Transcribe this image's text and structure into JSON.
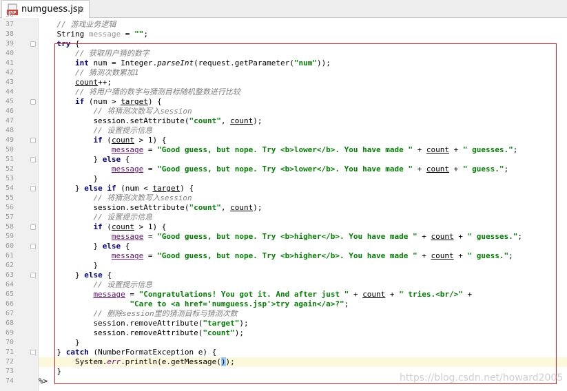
{
  "tab": {
    "title": "numguess.jsp",
    "close": "×"
  },
  "editor": {
    "lines": [
      {
        "n": "36",
        "tokens": []
      },
      {
        "n": "37",
        "indent": 4,
        "tokens": [
          {
            "t": "// 游戏业务逻辑",
            "c": "cmt"
          }
        ]
      },
      {
        "n": "38",
        "indent": 4,
        "tokens": [
          {
            "t": "String "
          },
          {
            "t": "message",
            "c": "fadevar"
          },
          {
            "t": " = "
          },
          {
            "t": "\"\"",
            "c": "str"
          },
          {
            "t": ";"
          }
        ]
      },
      {
        "n": "39",
        "indent": 4,
        "fold": true,
        "tokens": [
          {
            "t": "try",
            "c": "kw"
          },
          {
            "t": " {"
          }
        ]
      },
      {
        "n": "40",
        "indent": 8,
        "tokens": [
          {
            "t": "// 获取用户猜的数字",
            "c": "cmt"
          }
        ]
      },
      {
        "n": "41",
        "indent": 8,
        "tokens": [
          {
            "t": "int",
            "c": "kw"
          },
          {
            "t": " num = Integer."
          },
          {
            "t": "parseInt",
            "c": "mth"
          },
          {
            "t": "(request.getParameter("
          },
          {
            "t": "\"num\"",
            "c": "str"
          },
          {
            "t": "));"
          }
        ]
      },
      {
        "n": "42",
        "indent": 8,
        "tokens": [
          {
            "t": "// 猜测次数累加1",
            "c": "cmt"
          }
        ]
      },
      {
        "n": "43",
        "indent": 8,
        "tokens": [
          {
            "t": "count",
            "c": "var"
          },
          {
            "t": "++;"
          }
        ]
      },
      {
        "n": "44",
        "indent": 8,
        "tokens": [
          {
            "t": "// 将用户猜的数字与猜测目标随机整数进行比较",
            "c": "cmt"
          }
        ]
      },
      {
        "n": "45",
        "indent": 8,
        "fold": true,
        "tokens": [
          {
            "t": "if",
            "c": "kw"
          },
          {
            "t": " (num > "
          },
          {
            "t": "target",
            "c": "var"
          },
          {
            "t": ") {"
          }
        ]
      },
      {
        "n": "46",
        "indent": 12,
        "tokens": [
          {
            "t": "// 将猜测次数写入session",
            "c": "cmt"
          }
        ]
      },
      {
        "n": "47",
        "indent": 12,
        "tokens": [
          {
            "t": "session.setAttribute("
          },
          {
            "t": "\"count\"",
            "c": "str"
          },
          {
            "t": ", "
          },
          {
            "t": "count",
            "c": "var"
          },
          {
            "t": ");"
          }
        ]
      },
      {
        "n": "48",
        "indent": 12,
        "tokens": [
          {
            "t": "// 设置提示信息",
            "c": "cmt"
          }
        ]
      },
      {
        "n": "49",
        "indent": 12,
        "fold": true,
        "tokens": [
          {
            "t": "if",
            "c": "kw"
          },
          {
            "t": " ("
          },
          {
            "t": "count",
            "c": "var"
          },
          {
            "t": " > 1) {"
          }
        ]
      },
      {
        "n": "50",
        "indent": 16,
        "tokens": [
          {
            "t": "message",
            "c": "fld"
          },
          {
            "t": " = "
          },
          {
            "t": "\"Good guess, but nope. Try <b>lower</b>. You have made \"",
            "c": "str"
          },
          {
            "t": " + "
          },
          {
            "t": "count",
            "c": "var"
          },
          {
            "t": " + "
          },
          {
            "t": "\" guesses.\"",
            "c": "str"
          },
          {
            "t": ";"
          }
        ]
      },
      {
        "n": "51",
        "indent": 12,
        "fold": true,
        "tokens": [
          {
            "t": "} "
          },
          {
            "t": "else",
            "c": "kw"
          },
          {
            "t": " {"
          }
        ]
      },
      {
        "n": "52",
        "indent": 16,
        "tokens": [
          {
            "t": "message",
            "c": "fld"
          },
          {
            "t": " = "
          },
          {
            "t": "\"Good guess, but nope. Try <b>lower</b>. You have made \"",
            "c": "str"
          },
          {
            "t": " + "
          },
          {
            "t": "count",
            "c": "var"
          },
          {
            "t": " + "
          },
          {
            "t": "\" guess.\"",
            "c": "str"
          },
          {
            "t": ";"
          }
        ]
      },
      {
        "n": "53",
        "indent": 12,
        "tokens": [
          {
            "t": "}"
          }
        ]
      },
      {
        "n": "54",
        "indent": 8,
        "fold": true,
        "tokens": [
          {
            "t": "} "
          },
          {
            "t": "else if",
            "c": "kw"
          },
          {
            "t": " (num < "
          },
          {
            "t": "target",
            "c": "var"
          },
          {
            "t": ") {"
          }
        ]
      },
      {
        "n": "55",
        "indent": 12,
        "tokens": [
          {
            "t": "// 将猜测次数写入session",
            "c": "cmt"
          }
        ]
      },
      {
        "n": "56",
        "indent": 12,
        "tokens": [
          {
            "t": "session.setAttribute("
          },
          {
            "t": "\"count\"",
            "c": "str"
          },
          {
            "t": ", "
          },
          {
            "t": "count",
            "c": "var"
          },
          {
            "t": ");"
          }
        ]
      },
      {
        "n": "57",
        "indent": 12,
        "tokens": [
          {
            "t": "// 设置提示信息",
            "c": "cmt"
          }
        ]
      },
      {
        "n": "58",
        "indent": 12,
        "fold": true,
        "tokens": [
          {
            "t": "if",
            "c": "kw"
          },
          {
            "t": " ("
          },
          {
            "t": "count",
            "c": "var"
          },
          {
            "t": " > 1) {"
          }
        ]
      },
      {
        "n": "59",
        "indent": 16,
        "tokens": [
          {
            "t": "message",
            "c": "fld"
          },
          {
            "t": " = "
          },
          {
            "t": "\"Good guess, but nope. Try <b>higher</b>. You have made \"",
            "c": "str"
          },
          {
            "t": " + "
          },
          {
            "t": "count",
            "c": "var"
          },
          {
            "t": " + "
          },
          {
            "t": "\" guesses.\"",
            "c": "str"
          },
          {
            "t": ";"
          }
        ]
      },
      {
        "n": "60",
        "indent": 12,
        "fold": true,
        "tokens": [
          {
            "t": "} "
          },
          {
            "t": "else",
            "c": "kw"
          },
          {
            "t": " {"
          }
        ]
      },
      {
        "n": "61",
        "indent": 16,
        "tokens": [
          {
            "t": "message",
            "c": "fld"
          },
          {
            "t": " = "
          },
          {
            "t": "\"Good guess, but nope. Try <b>higher</b>. You have made \"",
            "c": "str"
          },
          {
            "t": " + "
          },
          {
            "t": "count",
            "c": "var"
          },
          {
            "t": " + "
          },
          {
            "t": "\" guess.\"",
            "c": "str"
          },
          {
            "t": ";"
          }
        ]
      },
      {
        "n": "62",
        "indent": 12,
        "tokens": [
          {
            "t": "}"
          }
        ]
      },
      {
        "n": "63",
        "indent": 8,
        "fold": true,
        "tokens": [
          {
            "t": "} "
          },
          {
            "t": "else",
            "c": "kw"
          },
          {
            "t": " {"
          }
        ]
      },
      {
        "n": "64",
        "indent": 12,
        "tokens": [
          {
            "t": "// 设置提示信息",
            "c": "cmt"
          }
        ]
      },
      {
        "n": "65",
        "indent": 12,
        "tokens": [
          {
            "t": "message",
            "c": "fld"
          },
          {
            "t": " = "
          },
          {
            "t": "\"Congratulations! You got it. And after just \"",
            "c": "str"
          },
          {
            "t": " + "
          },
          {
            "t": "count",
            "c": "var"
          },
          {
            "t": " + "
          },
          {
            "t": "\" tries.<br/>\"",
            "c": "str"
          },
          {
            "t": " +"
          }
        ]
      },
      {
        "n": "66",
        "indent": 20,
        "tokens": [
          {
            "t": "\"Care to <a href='numguess.jsp'>try again</a>?\"",
            "c": "str"
          },
          {
            "t": ";"
          }
        ]
      },
      {
        "n": "67",
        "indent": 12,
        "tokens": [
          {
            "t": "// 删除session里的猜测目标与猜测次数",
            "c": "cmt"
          }
        ]
      },
      {
        "n": "68",
        "indent": 12,
        "tokens": [
          {
            "t": "session.removeAttribute("
          },
          {
            "t": "\"target\"",
            "c": "str"
          },
          {
            "t": ");"
          }
        ]
      },
      {
        "n": "69",
        "indent": 12,
        "tokens": [
          {
            "t": "session.removeAttribute("
          },
          {
            "t": "\"count\"",
            "c": "str"
          },
          {
            "t": ");"
          }
        ]
      },
      {
        "n": "70",
        "indent": 8,
        "tokens": [
          {
            "t": "}"
          }
        ]
      },
      {
        "n": "71",
        "indent": 4,
        "fold": true,
        "tokens": [
          {
            "t": "} "
          },
          {
            "t": "catch",
            "c": "kw"
          },
          {
            "t": " (NumberFormatException e) {"
          }
        ]
      },
      {
        "n": "72",
        "indent": 8,
        "highlight": true,
        "tokens": [
          {
            "t": "System."
          },
          {
            "t": "err",
            "c": "err"
          },
          {
            "t": ".println(e.getMessage("
          },
          {
            "t": ")",
            "c": "brace"
          },
          {
            "t": ");"
          }
        ]
      },
      {
        "n": "73",
        "indent": 4,
        "tokens": [
          {
            "t": "}"
          }
        ]
      },
      {
        "n": "74",
        "indent": 0,
        "tokens": [
          {
            "t": "%>"
          }
        ]
      }
    ]
  },
  "watermark": "https://blog.csdn.net/howard2005",
  "colors": {
    "keyword": "#000080",
    "string": "#008000",
    "comment": "#808080",
    "field": "#660e7a",
    "selection_box": "#d9232d",
    "current_line": "#fbf8dc"
  }
}
